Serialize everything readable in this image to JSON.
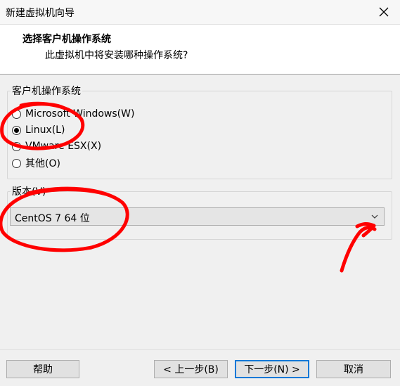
{
  "window": {
    "title": "新建虚拟机向导",
    "close_glyph": "✕"
  },
  "header": {
    "title": "选择客户机操作系统",
    "subtitle": "此虚拟机中将安装哪种操作系统?"
  },
  "os_group": {
    "label": "客户机操作系统",
    "options": [
      {
        "label": "Microsoft Windows(W)",
        "checked": false
      },
      {
        "label": "Linux(L)",
        "checked": true
      },
      {
        "label": "VMware ESX(X)",
        "checked": false
      },
      {
        "label": "其他(O)",
        "checked": false
      }
    ]
  },
  "version_group": {
    "label": "版本(V)",
    "selected": "CentOS 7 64 位"
  },
  "buttons": {
    "help": "帮助",
    "back": "< 上一步(B)",
    "next": "下一步(N) >",
    "cancel": "取消"
  },
  "colors": {
    "annotation_red": "#ff0000",
    "focus_blue": "#0078d7"
  }
}
